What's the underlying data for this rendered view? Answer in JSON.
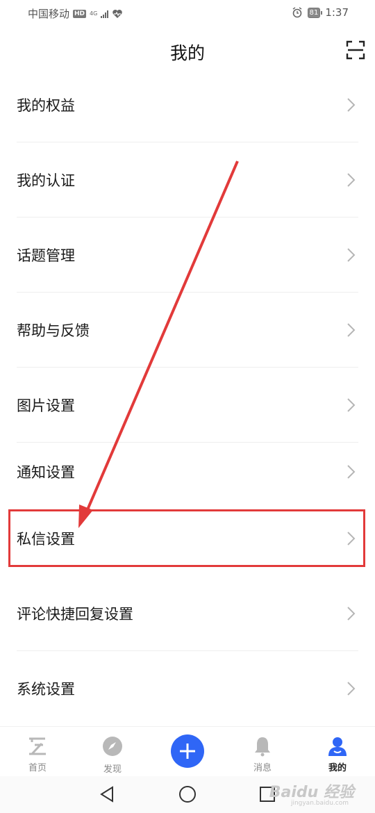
{
  "status_bar": {
    "carrier": "中国移动",
    "hd": "HD",
    "network": "4G",
    "battery": "81",
    "time": "1:37"
  },
  "header": {
    "title": "我的"
  },
  "menu": [
    {
      "label": "我的权益"
    },
    {
      "label": "我的认证"
    },
    {
      "label": "话题管理"
    },
    {
      "label": "帮助与反馈"
    },
    {
      "label": "图片设置"
    },
    {
      "label": "通知设置"
    },
    {
      "label": "私信设置"
    },
    {
      "label": "评论快捷回复设置"
    },
    {
      "label": "系统设置"
    }
  ],
  "tabs": [
    {
      "label": "首页",
      "icon": "home-icon"
    },
    {
      "label": "发现",
      "icon": "compass-icon"
    },
    {
      "label": "",
      "icon": "plus-icon"
    },
    {
      "label": "消息",
      "icon": "bell-icon"
    },
    {
      "label": "我的",
      "icon": "user-icon"
    }
  ],
  "watermark": {
    "text": "Baidu 经验",
    "sub": "jingyan.baidu.com"
  },
  "colors": {
    "accent": "#2f66f6",
    "annotation": "#e23a3a"
  }
}
